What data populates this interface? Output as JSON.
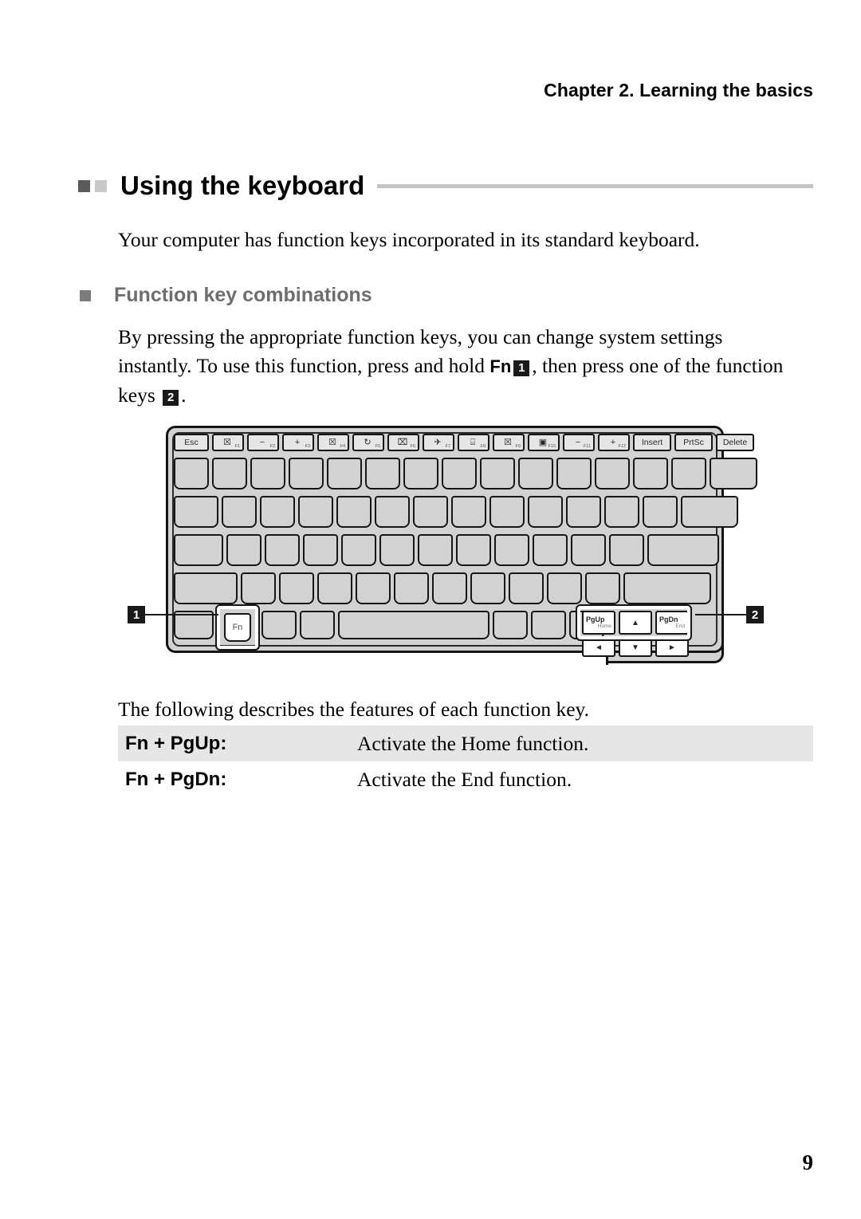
{
  "header": {
    "chapter": "Chapter 2. Learning the basics"
  },
  "heading": {
    "title": "Using the keyboard"
  },
  "intro": {
    "text": "Your computer has function keys incorporated in its standard keyboard."
  },
  "subheading": {
    "title": "Function key combinations"
  },
  "body": {
    "line1": "By pressing the appropriate function keys, you can change system settings",
    "line2a": "instantly. To use this function, press and hold ",
    "fn_label": "Fn",
    "badge1": "1",
    "line2b": ", then press one of the",
    "line3a": "function keys ",
    "badge2": "2",
    "line3b": "."
  },
  "figure": {
    "callout1": "1",
    "callout2": "2",
    "fn_key_label": "Fn",
    "function_row": [
      {
        "word": "Esc",
        "glyph": "",
        "fnum": "",
        "name": "escape"
      },
      {
        "word": "",
        "glyph": "☒",
        "fnum": "F1",
        "name": "speaker-mute-icon"
      },
      {
        "word": "",
        "glyph": "−",
        "fnum": "F2",
        "name": "volume-down-icon"
      },
      {
        "word": "",
        "glyph": "+",
        "fnum": "F3",
        "name": "volume-up-icon"
      },
      {
        "word": "",
        "glyph": "☒",
        "fnum": "F4",
        "name": "microphone-mute-icon"
      },
      {
        "word": "",
        "glyph": "↻",
        "fnum": "F5",
        "name": "refresh-icon"
      },
      {
        "word": "",
        "glyph": "⌧",
        "fnum": "F6",
        "name": "touchpad-toggle-icon"
      },
      {
        "word": "",
        "glyph": "✈",
        "fnum": "F7",
        "name": "airplane-mode-icon"
      },
      {
        "word": "",
        "glyph": "⌸",
        "fnum": "F8",
        "name": "keyboard-backlight-icon"
      },
      {
        "word": "",
        "glyph": "☒",
        "fnum": "F9",
        "name": "camera-off-icon"
      },
      {
        "word": "",
        "glyph": "▣",
        "fnum": "F10",
        "name": "display-switch-icon"
      },
      {
        "word": "",
        "glyph": "−",
        "fnum": "F11",
        "name": "brightness-down-icon"
      },
      {
        "word": "",
        "glyph": "+",
        "fnum": "F12",
        "name": "brightness-up-icon"
      },
      {
        "word": "Insert",
        "glyph": "",
        "fnum": "",
        "name": "insert"
      },
      {
        "word": "PrtSc",
        "glyph": "",
        "fnum": "",
        "name": "print-screen"
      },
      {
        "word": "Delete",
        "glyph": "",
        "fnum": "",
        "name": "delete"
      }
    ],
    "nav_cluster": {
      "pgup_top": "PgUp",
      "pgup_bot": "Home",
      "pgdn_top": "PgDn",
      "pgdn_bot": "End",
      "up": "▲",
      "down": "▼",
      "left": "◄",
      "right": "►"
    }
  },
  "table": {
    "intro": "The following describes the features of each function key.",
    "rows": [
      {
        "key": "Fn + PgUp:",
        "desc": "Activate the Home function."
      },
      {
        "key": "Fn + PgDn:",
        "desc": "Activate the End function."
      }
    ]
  },
  "footer": {
    "page_number": "9"
  },
  "colors": {
    "heading_rule": "#c4c4c4",
    "subheading_text": "#6e6e6e",
    "badge_bg": "#1a1a1a",
    "table_alt_row": "#e6e6e6",
    "key_face": "#d2d2d2"
  }
}
